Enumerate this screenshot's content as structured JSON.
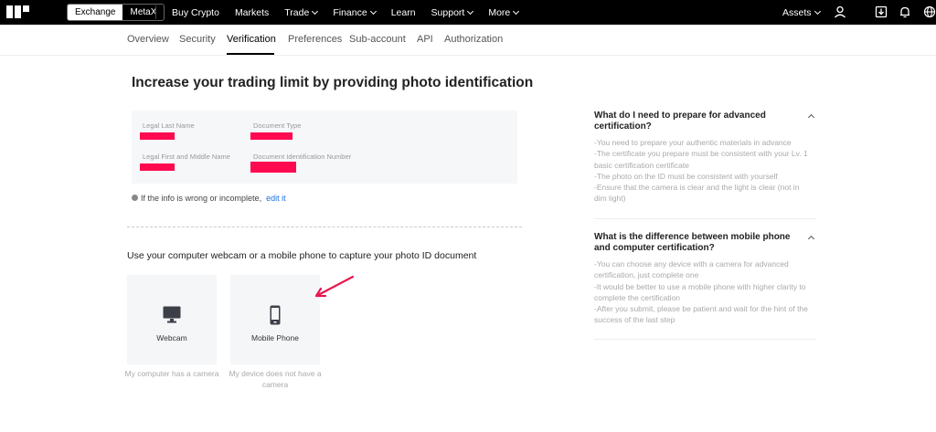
{
  "topbar": {
    "exchange_label": "Exchange",
    "metax_label": "MetaX",
    "nav": [
      {
        "label": "Buy Crypto",
        "caret": false
      },
      {
        "label": "Markets",
        "caret": false
      },
      {
        "label": "Trade",
        "caret": true
      },
      {
        "label": "Finance",
        "caret": true
      },
      {
        "label": "Learn",
        "caret": false
      },
      {
        "label": "Support",
        "caret": true
      },
      {
        "label": "More",
        "caret": true
      }
    ],
    "assets_label": "Assets",
    "assets_caret": true,
    "icons": [
      "user-icon",
      "download-icon",
      "bell-icon",
      "globe-icon"
    ]
  },
  "subnav": {
    "tabs": [
      "Overview",
      "Security",
      "Verification",
      "Preferences",
      "Sub-account",
      "API",
      "Authorization"
    ],
    "active_index": 2
  },
  "main": {
    "title": "Increase your trading limit by providing photo identification",
    "fields": {
      "last_name_label": "Legal Last Name",
      "doc_type_label": "Document Type",
      "first_middle_label": "Legal First and Middle Name",
      "doc_id_label": "Document Identification Number"
    },
    "note_text": "If the info is wrong or incomplete,",
    "edit_link": "edit it",
    "capture_title": "Use your computer webcam or a mobile phone to capture your photo ID document",
    "options": [
      {
        "label": "Webcam",
        "desc": "My computer has a camera",
        "icon": "monitor-icon"
      },
      {
        "label": "Mobile Phone",
        "desc": "My device does not have a camera",
        "icon": "phone-icon"
      }
    ]
  },
  "faq": [
    {
      "question": "What do I need to prepare for advanced certification?",
      "answer": "-You need to prepare your authentic materials in advance\n-The certificate you prepare must be consistent with your Lv. 1 basic certification certificate\n-The photo on the ID must be consistent with yourself\n-Ensure that the camera is clear and the light is clear (not in dim light)"
    },
    {
      "question": "What is the difference between mobile phone and computer certification?",
      "answer": "-You can choose any device with a camera for advanced certification, just complete one\n-It would be better to use a mobile phone with higher clarity to complete the certification\n-After you submit, please be patient and wait for the hint of the success of the last step"
    }
  ],
  "colors": {
    "brand": "#000000",
    "link": "#1f6fe0",
    "redaction": "#ff0a50",
    "annotation_arrow": "#e8174f"
  }
}
